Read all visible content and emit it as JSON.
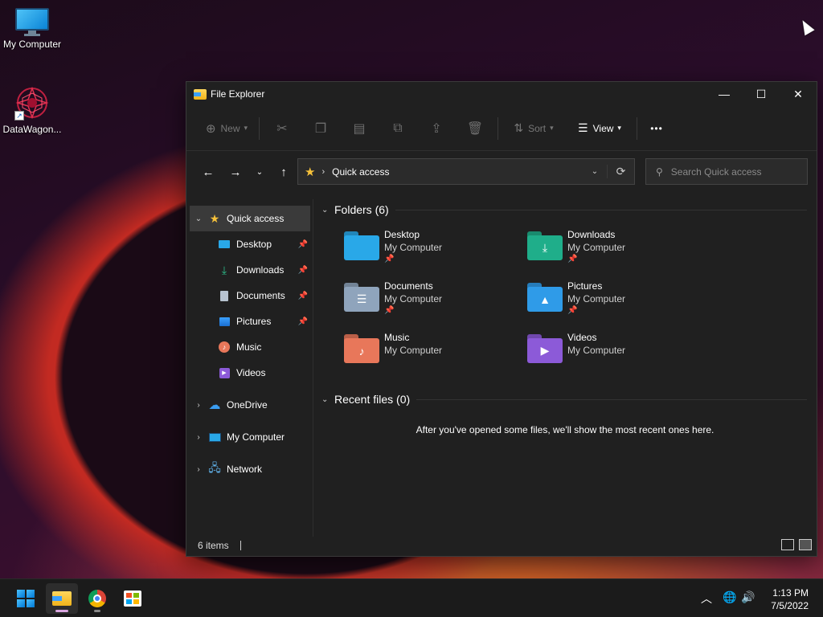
{
  "desktop": {
    "icons": [
      {
        "label": "My Computer"
      },
      {
        "label": "DataWagon..."
      }
    ]
  },
  "window": {
    "title": "File Explorer",
    "controls": {
      "minimize": "—",
      "maximize": "☐",
      "close": "✕"
    },
    "toolbar": {
      "new_label": "New",
      "sort_label": "Sort",
      "view_label": "View",
      "more_label": "•••"
    },
    "address": {
      "crumb": "Quick access"
    },
    "search": {
      "placeholder": "Search Quick access"
    },
    "sidebar": {
      "quick_access": "Quick access",
      "items": [
        {
          "label": "Desktop",
          "pinned": true
        },
        {
          "label": "Downloads",
          "pinned": true
        },
        {
          "label": "Documents",
          "pinned": true
        },
        {
          "label": "Pictures",
          "pinned": true
        },
        {
          "label": "Music",
          "pinned": false
        },
        {
          "label": "Videos",
          "pinned": false
        }
      ],
      "onedrive": "OneDrive",
      "my_computer": "My Computer",
      "network": "Network"
    },
    "main": {
      "folders_header": "Folders (6)",
      "folders": [
        {
          "name": "Desktop",
          "location": "My Computer",
          "pinned": true,
          "color": "#29a8e8"
        },
        {
          "name": "Downloads",
          "location": "My Computer",
          "pinned": true,
          "color": "#1fae8a"
        },
        {
          "name": "Documents",
          "location": "My Computer",
          "pinned": true,
          "color": "#8fa4bc"
        },
        {
          "name": "Pictures",
          "location": "My Computer",
          "pinned": true,
          "color": "#2f9be8"
        },
        {
          "name": "Music",
          "location": "My Computer",
          "pinned": false,
          "color": "#e8775a"
        },
        {
          "name": "Videos",
          "location": "My Computer",
          "pinned": false,
          "color": "#8c5ad8"
        }
      ],
      "recent_header": "Recent files (0)",
      "recent_empty": "After you've opened some files, we'll show the most recent ones here."
    },
    "status": {
      "items_count": "6 items"
    }
  },
  "taskbar": {
    "clock_time": "1:13 PM",
    "clock_date": "7/5/2022"
  }
}
